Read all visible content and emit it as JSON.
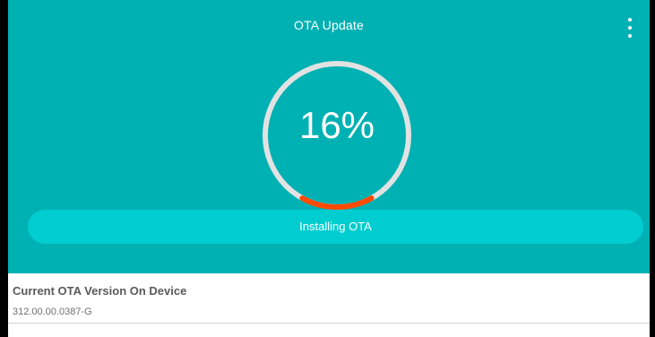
{
  "app": {
    "title": "OTA Update",
    "menu_icon": "more-vert-icon"
  },
  "progress": {
    "percent": 16,
    "label": "16%",
    "status": "Installing OTA"
  },
  "info": {
    "label": "Current OTA Version On Device",
    "value": "312.00.00.0387-G"
  },
  "colors": {
    "header": "#00b1b3",
    "button": "#00cdd0",
    "ring_track": "#e2e2e2",
    "ring_progress": "#ff4a00",
    "text_on_header": "#ffffff"
  }
}
